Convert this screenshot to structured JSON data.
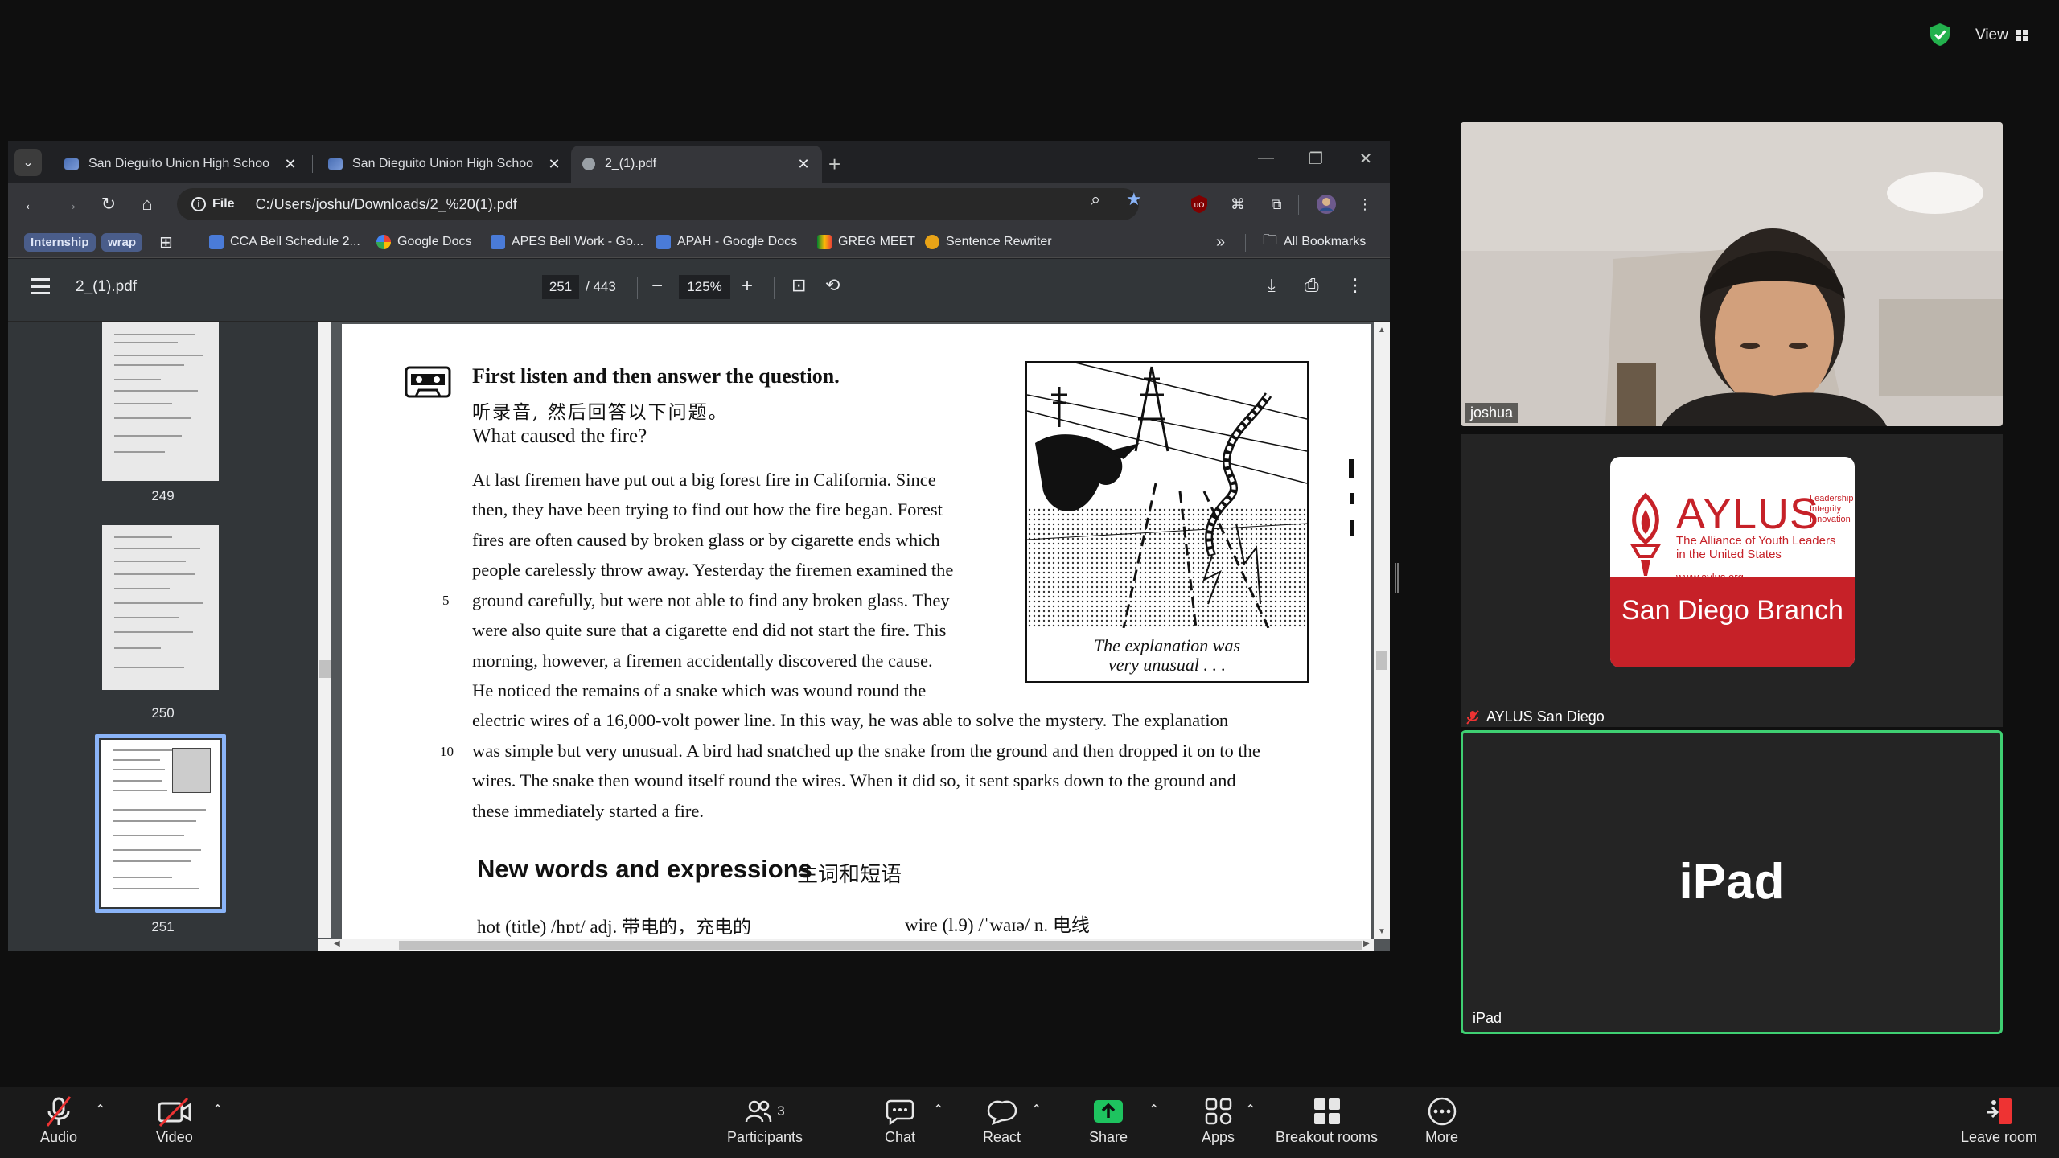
{
  "zoom": {
    "view_label": "View",
    "controls": {
      "audio": "Audio",
      "video": "Video",
      "participants": "Participants",
      "participants_count": "3",
      "chat": "Chat",
      "react": "React",
      "share": "Share",
      "apps": "Apps",
      "breakout": "Breakout rooms",
      "more": "More",
      "leave": "Leave room"
    },
    "tiles": {
      "joshua": "joshua",
      "aylus_name": "AYLUS San Diego",
      "ipad_center": "iPad",
      "ipad_name": "iPad"
    },
    "aylus_logo": {
      "word": "AYLUS",
      "side": [
        "Leadership",
        "Integrity",
        "Innovation"
      ],
      "tag1": "The Alliance of Youth Leaders",
      "tag2": "in the United States",
      "url": "www.aylus.org",
      "band": "San Diego Branch"
    }
  },
  "browser": {
    "tabs": [
      {
        "title": "San Dieguito Union High Schoo"
      },
      {
        "title": "San Dieguito Union High Schoo"
      },
      {
        "title": "2_(1).pdf"
      }
    ],
    "url_scheme": "File",
    "url": "C:/Users/joshu/Downloads/2_%20(1).pdf",
    "bookmarks": {
      "chip1": "Internship",
      "chip2": "wrap",
      "items": [
        "CCA Bell Schedule 2...",
        "Google Docs",
        "APES Bell Work - Go...",
        "APAH - Google Docs",
        "GREG MEET",
        "Sentence Rewriter"
      ],
      "all": "All Bookmarks"
    }
  },
  "pdf": {
    "title": "2_(1).pdf",
    "page": "251",
    "total": "/ 443",
    "zoom": "125%",
    "thumb_labels": [
      "249",
      "250",
      "251"
    ],
    "content": {
      "heading": "First listen and then answer the question.",
      "heading_cn": "听录音, 然后回答以下问题。",
      "question": "What caused the fire?",
      "para_lines": [
        "At last firemen have put out a big forest fire in California. Since",
        "then, they have been trying to find out how the fire began. Forest",
        "fires are often caused by broken glass or by cigarette ends which",
        "people carelessly throw away. Yesterday the firemen examined the",
        "ground carefully, but were not able to find any broken glass. They",
        "were also quite sure that a cigarette end did not start the fire. This",
        "morning, however, a firemen accidentally discovered the cause.",
        "He noticed the remains of a snake which was wound round the"
      ],
      "para_full_lines": [
        "electric wires of a 16,000-volt power line. In this way, he was able to solve the mystery. The explanation",
        "was simple but very unusual. A bird had snatched up the snake from the ground and then dropped it on to the",
        "wires. The snake then wound itself round the wires. When it did so, it sent sparks down to the ground and",
        "these immediately started a fire."
      ],
      "line5": "5",
      "line10": "10",
      "caption1": "The explanation was",
      "caption2": "very unusual . . .",
      "h2": "New words and expressions",
      "h2_cn": "生词和短语",
      "gloss1": "hot (title) /hɒt/ adj. 带电的，充电的",
      "gloss2": "wire (l.9) /ˈwaɪə/ n. 电线"
    }
  }
}
